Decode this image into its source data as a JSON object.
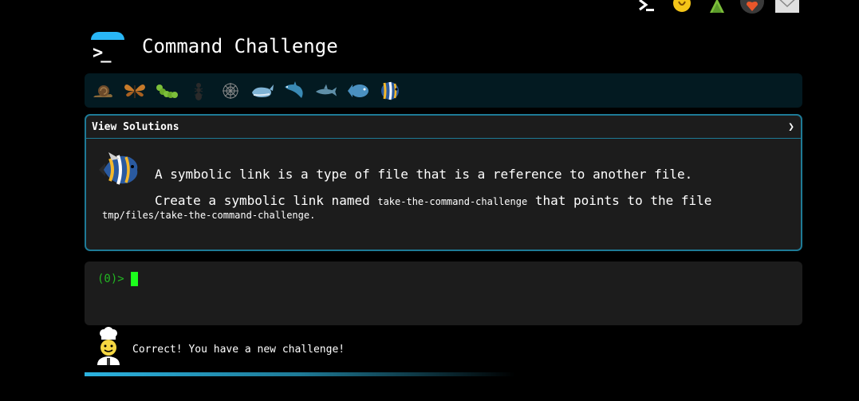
{
  "app": {
    "title": "Command Challenge",
    "logo_text": ">_"
  },
  "top_icons": [
    {
      "name": "terminal-icon"
    },
    {
      "name": "lightbulb-icon"
    },
    {
      "name": "tree-icon"
    },
    {
      "name": "heart-badge-icon"
    },
    {
      "name": "envelope-icon"
    }
  ],
  "levels": [
    {
      "name": "snail-icon"
    },
    {
      "name": "butterfly-icon"
    },
    {
      "name": "caterpillar-icon"
    },
    {
      "name": "ant-icon"
    },
    {
      "name": "spider-web-icon"
    },
    {
      "name": "whale-icon"
    },
    {
      "name": "dolphin-icon"
    },
    {
      "name": "shark-icon"
    },
    {
      "name": "fish-icon"
    },
    {
      "name": "tropical-fish-icon"
    }
  ],
  "challenge": {
    "solutions_label": "View Solutions",
    "solutions_chevron": "❯",
    "line1": "A symbolic link is a type of file that is a reference to another file.",
    "line2_prefix": "Create a symbolic link named ",
    "line2_code": "take-the-command-challenge",
    "line2_suffix": " that points to the file",
    "line3_code": "tmp/files/take-the-command-challenge",
    "line3_suffix": "."
  },
  "terminal": {
    "prompt": "(0)>"
  },
  "feedback": {
    "message": "Correct! You have a new challenge!"
  },
  "colors": {
    "accent": "#1e7a96",
    "prompt_green": "#22b822",
    "cursor_green": "#1cff1c"
  }
}
